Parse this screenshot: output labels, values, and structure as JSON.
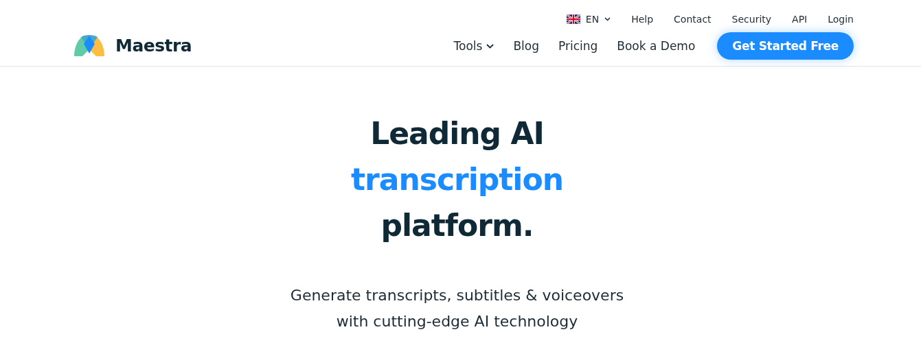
{
  "header": {
    "logo": {
      "name": "Maestra"
    },
    "language": {
      "label": "EN"
    },
    "top_links": [
      "Help",
      "Contact",
      "Security",
      "API",
      "Login"
    ],
    "nav": [
      {
        "label": "Tools",
        "kind": "dropdown"
      },
      {
        "label": "Blog",
        "kind": "link"
      },
      {
        "label": "Pricing",
        "kind": "link"
      },
      {
        "label": "Book a Demo",
        "kind": "link"
      }
    ],
    "cta": "Get Started Free"
  },
  "hero": {
    "headline": [
      {
        "text": "Leading AI",
        "highlight": false
      },
      {
        "text": "transcription",
        "highlight": true
      },
      {
        "text": "platform.",
        "highlight": false
      }
    ],
    "subtitle": [
      "Generate transcripts, subtitles & voiceovers",
      "with cutting-edge AI technology"
    ]
  }
}
